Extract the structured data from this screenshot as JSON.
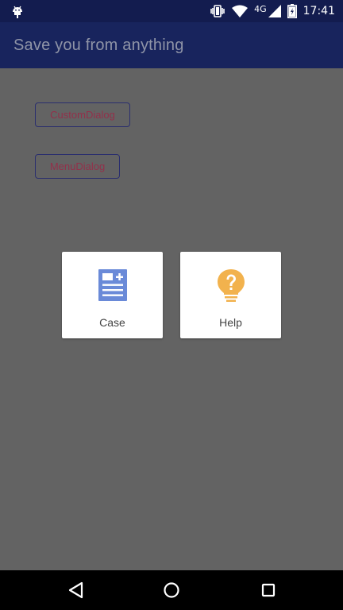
{
  "status_bar": {
    "network": "4G",
    "time": "17:41",
    "icons": [
      "android-debug-icon",
      "vibrate-icon",
      "wifi-icon",
      "signal-icon",
      "battery-charging-icon"
    ]
  },
  "app_bar": {
    "title": "Save you from anything"
  },
  "buttons": {
    "custom_dialog": "CustomDialog",
    "menu_dialog": "MenuDialog"
  },
  "dialog": {
    "items": [
      {
        "label": "Case",
        "icon": "case-document-icon",
        "color": "#6a8ad8"
      },
      {
        "label": "Help",
        "icon": "lightbulb-question-icon",
        "color": "#f2b24d"
      }
    ]
  },
  "colors": {
    "status_bar": "#131c4f",
    "app_bar": "#18245d",
    "scrim": "#636363",
    "button_text": "#93304a"
  },
  "nav_bar": {
    "icons": [
      "back-icon",
      "home-icon",
      "recents-icon"
    ]
  }
}
